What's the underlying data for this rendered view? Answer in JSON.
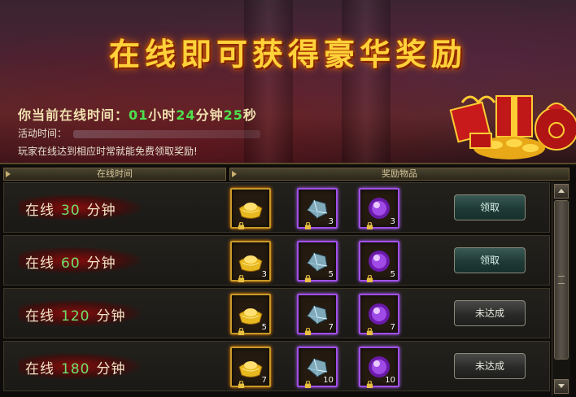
{
  "banner": {
    "title": "在线即可获得豪华奖励",
    "online_prefix": "你当前在线时间：",
    "hours": "01",
    "hours_unit": "小时",
    "minutes": "24",
    "minutes_unit": "分钟",
    "seconds": "25",
    "seconds_unit": "秒",
    "activity_label": "活动时间：",
    "description": "玩家在线达到相应时常就能免费领取奖励!"
  },
  "headers": {
    "online_time": "在线时间",
    "reward_items": "奖励物品"
  },
  "rows": [
    {
      "prefix": "在线",
      "minutes": "30",
      "unit": "分钟",
      "button": "领取",
      "button_state": "claim",
      "items": [
        {
          "icon": "gold-ingot-icon",
          "qty": ""
        },
        {
          "icon": "crystal-ore-icon",
          "qty": "3"
        },
        {
          "icon": "purple-orb-icon",
          "qty": "3"
        }
      ]
    },
    {
      "prefix": "在线",
      "minutes": "60",
      "unit": "分钟",
      "button": "领取",
      "button_state": "claim",
      "items": [
        {
          "icon": "gold-ingot-icon",
          "qty": "3"
        },
        {
          "icon": "crystal-ore-icon",
          "qty": "5"
        },
        {
          "icon": "purple-orb-icon",
          "qty": "5"
        }
      ]
    },
    {
      "prefix": "在线",
      "minutes": "120",
      "unit": "分钟",
      "button": "未达成",
      "button_state": "pending",
      "items": [
        {
          "icon": "gold-ingot-icon",
          "qty": "5"
        },
        {
          "icon": "crystal-ore-icon",
          "qty": "7"
        },
        {
          "icon": "purple-orb-icon",
          "qty": "7"
        }
      ]
    },
    {
      "prefix": "在线",
      "minutes": "180",
      "unit": "分钟",
      "button": "未达成",
      "button_state": "pending",
      "items": [
        {
          "icon": "gold-ingot-icon",
          "qty": "7"
        },
        {
          "icon": "crystal-ore-icon",
          "qty": "10"
        },
        {
          "icon": "purple-orb-icon",
          "qty": "10"
        }
      ]
    }
  ],
  "colors": {
    "title_gold": "#ffd23a",
    "time_green": "#4ce04c",
    "row_label_red": "#960a0a",
    "item_gold_border": "#c89a28",
    "item_purple_border": "#a050e8"
  }
}
